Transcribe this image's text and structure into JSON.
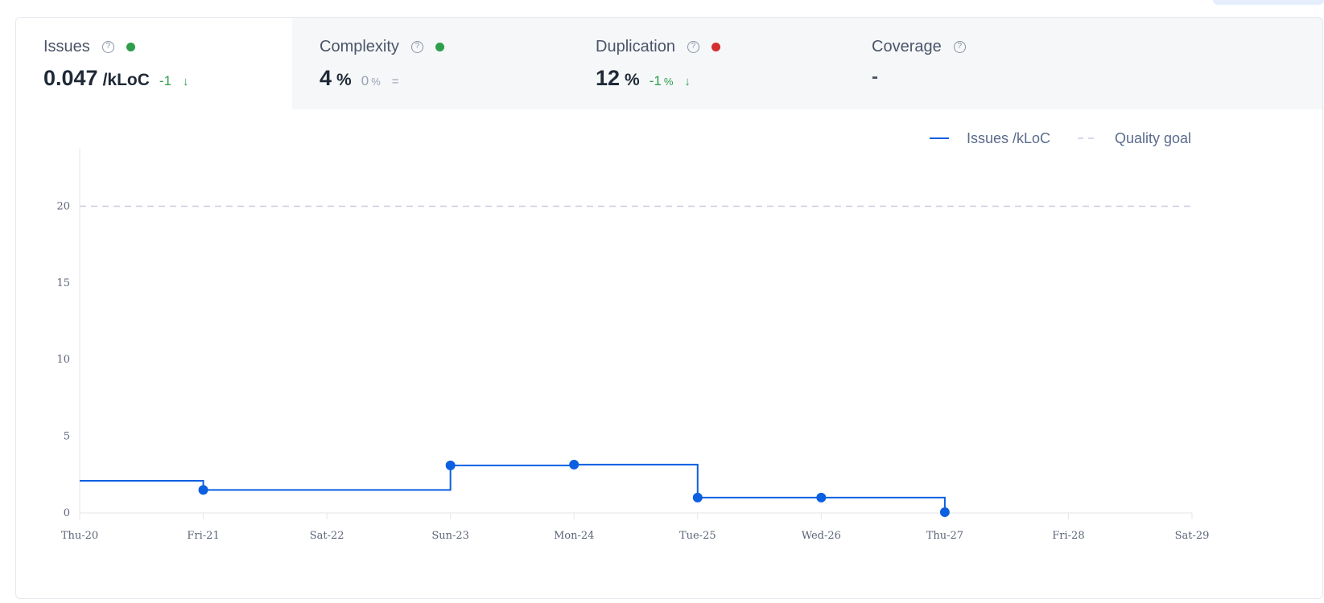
{
  "metrics": [
    {
      "title": "Issues",
      "value": "0.047",
      "unit": "/kLoC",
      "delta": "-1",
      "delta_unit": "",
      "trend": "↓",
      "status_color": "#2e9e4a"
    },
    {
      "title": "Complexity",
      "value": "4",
      "unit": "%",
      "delta": "0",
      "delta_unit": "%",
      "trend": "=",
      "status_color": "#2e9e4a"
    },
    {
      "title": "Duplication",
      "value": "12",
      "unit": "%",
      "delta": "-1",
      "delta_unit": "%",
      "trend": "↓",
      "status_color": "#d32f2f"
    },
    {
      "title": "Coverage",
      "value": "-"
    }
  ],
  "help_glyph": "?",
  "chart_data": {
    "type": "line",
    "step": true,
    "categories": [
      "Thu-20",
      "Fri-21",
      "Sat-22",
      "Sun-23",
      "Mon-24",
      "Tue-25",
      "Wed-26",
      "Thu-27",
      "Fri-28",
      "Sat-29"
    ],
    "yticks": [
      "0",
      "5",
      "10",
      "15",
      "20"
    ],
    "ylim": [
      0,
      23.8
    ],
    "series": [
      {
        "name": "Issues /kLoC",
        "color": "#0b5fe0",
        "points": [
          [
            0,
            2.1
          ],
          [
            1,
            1.5
          ],
          [
            3,
            3.1
          ],
          [
            4,
            3.15
          ],
          [
            5,
            1.0
          ],
          [
            6,
            1.0
          ],
          [
            7,
            0.05
          ]
        ],
        "markers": [
          1,
          3,
          4,
          5,
          6,
          7
        ]
      }
    ],
    "goal": {
      "name": "Quality goal",
      "value": 20,
      "color": "#c9cbe0"
    },
    "legend": "top-right",
    "grid": false
  }
}
